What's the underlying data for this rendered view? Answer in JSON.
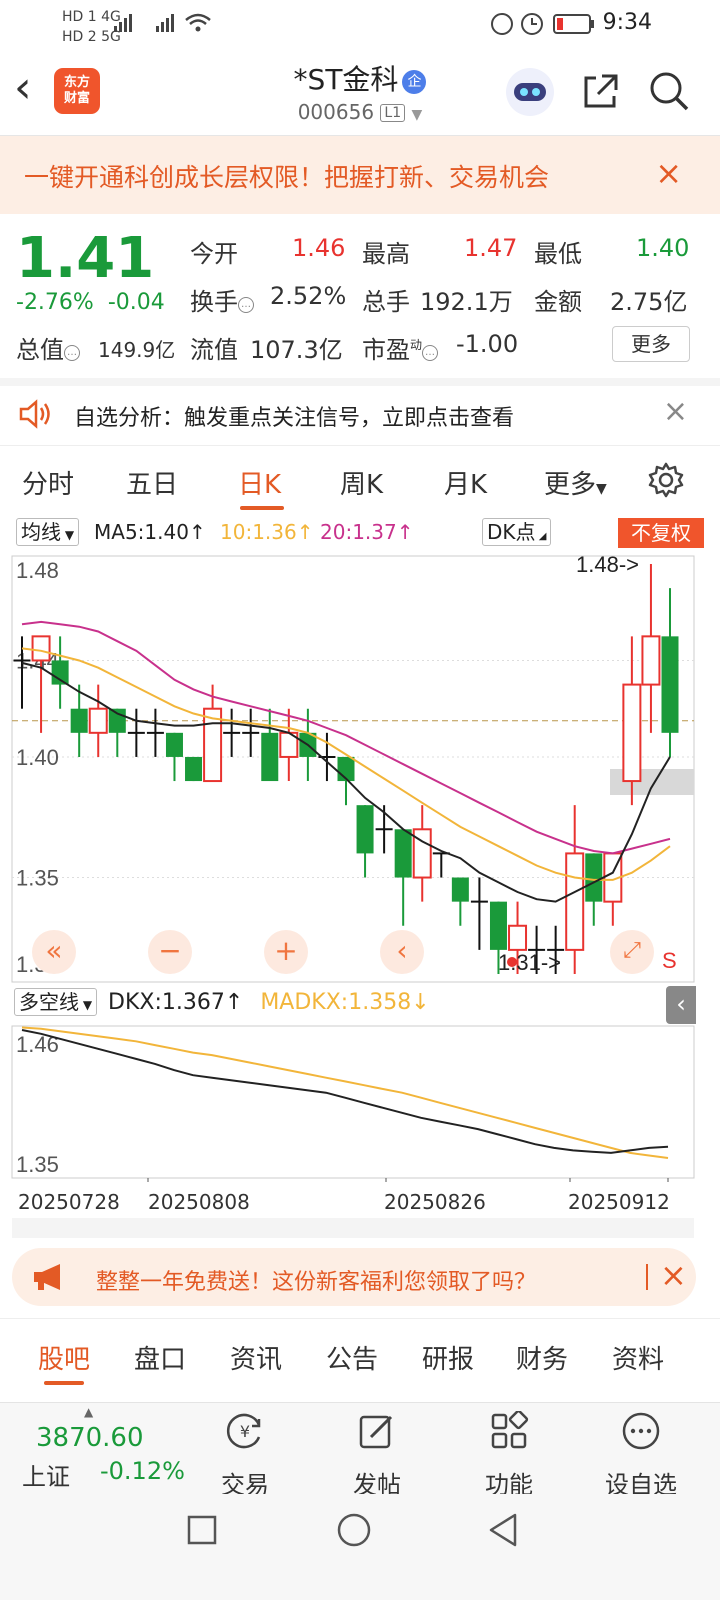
{
  "status": {
    "time": "9:34",
    "left_top": "HD 1  4G",
    "left_bottom": "HD 2  5G"
  },
  "header": {
    "stock_name": "*ST金科",
    "badge": "企",
    "stock_code": "000656",
    "code_tag": "L1",
    "logo_line1": "东方",
    "logo_line2": "财富"
  },
  "promo": {
    "text": "一键开通科创成长层权限！把握打新、交易机会",
    "close": "×"
  },
  "quote": {
    "price": "1.41",
    "change_pct": "-2.76%",
    "change_abs": "-0.04",
    "open_label": "今开",
    "open": "1.46",
    "high_label": "最高",
    "high": "1.47",
    "low_label": "最低",
    "low": "1.40",
    "turnover_label": "换手",
    "turnover": "2.52%",
    "volume_label": "总手",
    "volume": "192.1万",
    "amount_label": "金额",
    "amount": "2.75亿",
    "mktcap_label": "总值",
    "mktcap": "149.9亿",
    "float_label": "流值",
    "float": "107.3亿",
    "pe_label": "市盈",
    "pe_sup": "动",
    "pe": "-1.00",
    "more": "更多"
  },
  "analysis": {
    "text": "自选分析：触发重点关注信号，立即点击查看",
    "close": "×"
  },
  "tabs": {
    "items": [
      "分时",
      "五日",
      "日K",
      "周K",
      "月K",
      "更多"
    ],
    "active": "日K"
  },
  "ma": {
    "selector": "均线",
    "ma5": "MA5:1.40",
    "ma10": "10:1.36",
    "ma20": "20:1.37",
    "dk": "DK点",
    "fq": "不复权"
  },
  "colors": {
    "up": "#e8332f",
    "down": "#1a9a3a",
    "ma5": "#222222",
    "ma10": "#f2b53a",
    "ma20": "#c8318c",
    "accent": "#e35a25"
  },
  "chart_data": [
    {
      "type": "candlestick",
      "ylim": [
        1.31,
        1.48
      ],
      "y_ticks": [
        "1.48",
        "1.44",
        "1.40",
        "1.35",
        "1.31"
      ],
      "annotations": [
        "1.48->",
        "1.31->",
        "S"
      ],
      "candles": [
        [
          1.44,
          1.44,
          1.45,
          1.42
        ],
        [
          1.44,
          1.45,
          1.45,
          1.41
        ],
        [
          1.44,
          1.43,
          1.45,
          1.42
        ],
        [
          1.42,
          1.41,
          1.43,
          1.4
        ],
        [
          1.41,
          1.42,
          1.43,
          1.4
        ],
        [
          1.42,
          1.41,
          1.42,
          1.4
        ],
        [
          1.41,
          1.41,
          1.42,
          1.4
        ],
        [
          1.41,
          1.41,
          1.42,
          1.4
        ],
        [
          1.41,
          1.4,
          1.41,
          1.39
        ],
        [
          1.4,
          1.39,
          1.4,
          1.39
        ],
        [
          1.39,
          1.42,
          1.43,
          1.39
        ],
        [
          1.41,
          1.41,
          1.42,
          1.4
        ],
        [
          1.41,
          1.41,
          1.42,
          1.4
        ],
        [
          1.41,
          1.39,
          1.42,
          1.39
        ],
        [
          1.4,
          1.41,
          1.42,
          1.39
        ],
        [
          1.41,
          1.4,
          1.42,
          1.39
        ],
        [
          1.4,
          1.4,
          1.41,
          1.39
        ],
        [
          1.4,
          1.39,
          1.4,
          1.38
        ],
        [
          1.38,
          1.36,
          1.38,
          1.35
        ],
        [
          1.37,
          1.37,
          1.38,
          1.36
        ],
        [
          1.37,
          1.35,
          1.37,
          1.33
        ],
        [
          1.35,
          1.37,
          1.38,
          1.34
        ],
        [
          1.36,
          1.36,
          1.36,
          1.35
        ],
        [
          1.35,
          1.34,
          1.35,
          1.33
        ],
        [
          1.34,
          1.34,
          1.35,
          1.32
        ],
        [
          1.34,
          1.32,
          1.34,
          1.31
        ],
        [
          1.32,
          1.33,
          1.34,
          1.31
        ],
        [
          1.32,
          1.32,
          1.33,
          1.31
        ],
        [
          1.32,
          1.32,
          1.33,
          1.31
        ],
        [
          1.32,
          1.36,
          1.38,
          1.31
        ],
        [
          1.36,
          1.34,
          1.36,
          1.33
        ],
        [
          1.34,
          1.36,
          1.36,
          1.33
        ],
        [
          1.39,
          1.43,
          1.45,
          1.38
        ],
        [
          1.43,
          1.45,
          1.48,
          1.41
        ],
        [
          1.45,
          1.41,
          1.47,
          1.4
        ]
      ],
      "ma5": [
        1.439,
        1.437,
        1.432,
        1.427,
        1.423,
        1.418,
        1.415,
        1.414,
        1.413,
        1.413,
        1.414,
        1.414,
        1.413,
        1.412,
        1.41,
        1.405,
        1.398,
        1.391,
        1.383,
        1.377,
        1.37,
        1.365,
        1.361,
        1.358,
        1.352,
        1.348,
        1.344,
        1.341,
        1.34,
        1.344,
        1.348,
        1.352,
        1.368,
        1.387,
        1.4
      ],
      "ma10": [
        1.445,
        1.444,
        1.442,
        1.44,
        1.437,
        1.433,
        1.429,
        1.425,
        1.421,
        1.418,
        1.416,
        1.415,
        1.414,
        1.413,
        1.412,
        1.41,
        1.406,
        1.401,
        1.396,
        1.391,
        1.386,
        1.381,
        1.376,
        1.371,
        1.367,
        1.363,
        1.359,
        1.355,
        1.352,
        1.35,
        1.349,
        1.349,
        1.352,
        1.357,
        1.363
      ],
      "ma20": [
        1.455,
        1.456,
        1.455,
        1.454,
        1.452,
        1.448,
        1.444,
        1.438,
        1.432,
        1.428,
        1.425,
        1.423,
        1.421,
        1.419,
        1.417,
        1.415,
        1.412,
        1.409,
        1.405,
        1.401,
        1.397,
        1.393,
        1.389,
        1.385,
        1.381,
        1.377,
        1.373,
        1.369,
        1.366,
        1.363,
        1.361,
        1.36,
        1.362,
        1.364,
        1.366
      ]
    },
    {
      "type": "line",
      "title": "多空线",
      "ylim": [
        1.35,
        1.46
      ],
      "y_ticks": [
        "1.46",
        "1.35"
      ],
      "x_ticks": [
        "20250728",
        "20250808",
        "20250826",
        "20250912"
      ],
      "series": [
        {
          "name": "DKX",
          "label": "DKX:1.367",
          "color": "#222222",
          "values": [
            1.46,
            1.457,
            1.453,
            1.449,
            1.445,
            1.441,
            1.437,
            1.433,
            1.428,
            1.424,
            1.422,
            1.42,
            1.418,
            1.416,
            1.414,
            1.412,
            1.41,
            1.406,
            1.402,
            1.398,
            1.394,
            1.39,
            1.387,
            1.384,
            1.381,
            1.377,
            1.373,
            1.369,
            1.366,
            1.364,
            1.363,
            1.362,
            1.364,
            1.366,
            1.367
          ]
        },
        {
          "name": "MADKX",
          "label": "MADKX:1.358",
          "color": "#f2b53a",
          "values": [
            1.462,
            1.461,
            1.459,
            1.457,
            1.455,
            1.453,
            1.451,
            1.448,
            1.445,
            1.442,
            1.44,
            1.437,
            1.434,
            1.431,
            1.428,
            1.425,
            1.422,
            1.419,
            1.416,
            1.413,
            1.41,
            1.406,
            1.402,
            1.398,
            1.394,
            1.39,
            1.386,
            1.382,
            1.378,
            1.374,
            1.37,
            1.366,
            1.362,
            1.36,
            1.358
          ]
        }
      ]
    }
  ],
  "ad": {
    "text": "整整一年免费送！这份新客福利您领取了吗？",
    "close": "×"
  },
  "bottom_tabs": {
    "items": [
      "股吧",
      "盘口",
      "资讯",
      "公告",
      "研报",
      "财务",
      "资料"
    ],
    "active": "股吧"
  },
  "toolbar": {
    "index_value": "3870.60",
    "index_name": "上证",
    "index_change": "-0.12%",
    "trade": "交易",
    "post": "发帖",
    "function": "功能",
    "watch": "设自选"
  }
}
